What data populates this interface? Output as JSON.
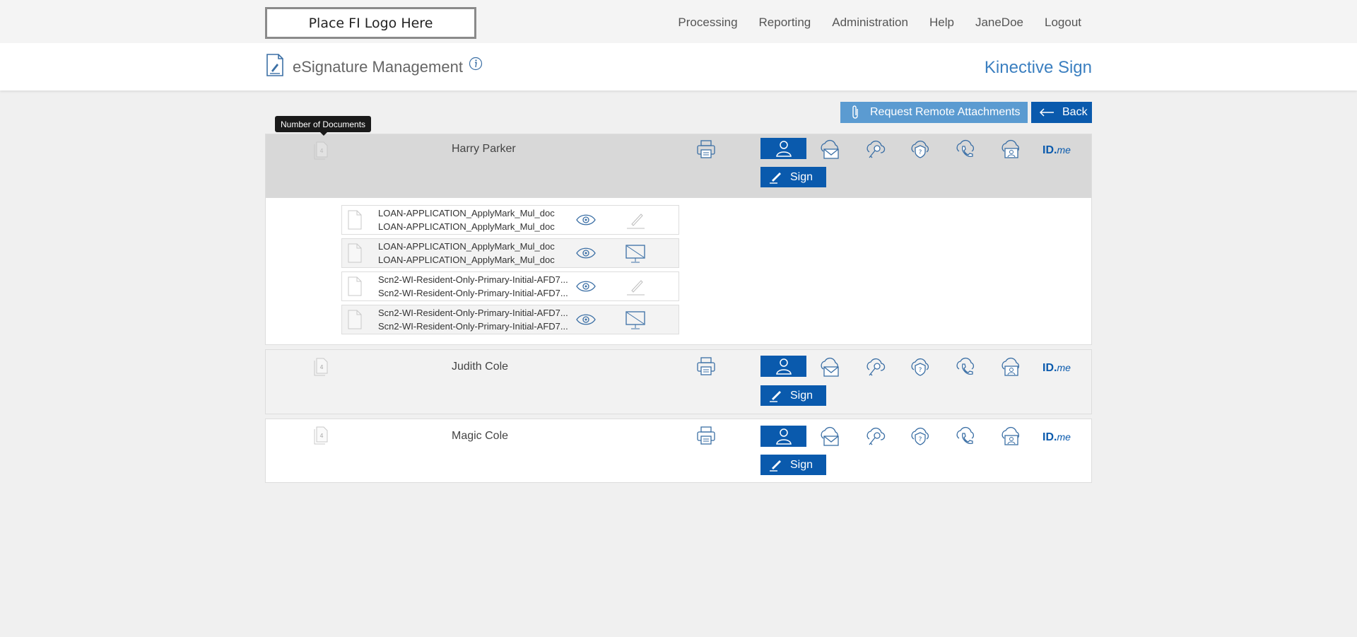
{
  "header": {
    "logo_text": "Place FI Logo Here",
    "nav": [
      "Processing",
      "Reporting",
      "Administration",
      "Help",
      "JaneDoe",
      "Logout"
    ]
  },
  "title_bar": {
    "title": "eSignature Management",
    "brand": "Kinective Sign"
  },
  "actions": {
    "attach_label": "Request Remote Attachments",
    "back_label": "Back"
  },
  "tooltip": "Number of Documents",
  "signers": [
    {
      "name": "Harry Parker",
      "doc_count": "4",
      "sign_label": "Sign",
      "idme_label": "ID.",
      "idme_suffix": "me",
      "documents": [
        {
          "line1": "LOAN-APPLICATION_ApplyMark_Mul_doc",
          "line2": "LOAN-APPLICATION_ApplyMark_Mul_doc",
          "action": "pen-icon"
        },
        {
          "line1": "LOAN-APPLICATION_ApplyMark_Mul_doc",
          "line2": "LOAN-APPLICATION_ApplyMark_Mul_doc",
          "action": "monitor-off-icon"
        },
        {
          "line1": "Scn2-WI-Resident-Only-Primary-Initial-AFD7...",
          "line2": "Scn2-WI-Resident-Only-Primary-Initial-AFD7...",
          "action": "pen-icon"
        },
        {
          "line1": "Scn2-WI-Resident-Only-Primary-Initial-AFD7...",
          "line2": "Scn2-WI-Resident-Only-Primary-Initial-AFD7...",
          "action": "monitor-off-icon"
        }
      ]
    },
    {
      "name": "Judith Cole",
      "doc_count": "4",
      "sign_label": "Sign",
      "idme_label": "ID.",
      "idme_suffix": "me"
    },
    {
      "name": "Magic Cole",
      "doc_count": "4",
      "sign_label": "Sign",
      "idme_label": "ID.",
      "idme_suffix": "me"
    }
  ],
  "colors": {
    "primary": "#0a5aad",
    "secondary": "#5b9bd1",
    "brand": "#3b7fc0"
  }
}
